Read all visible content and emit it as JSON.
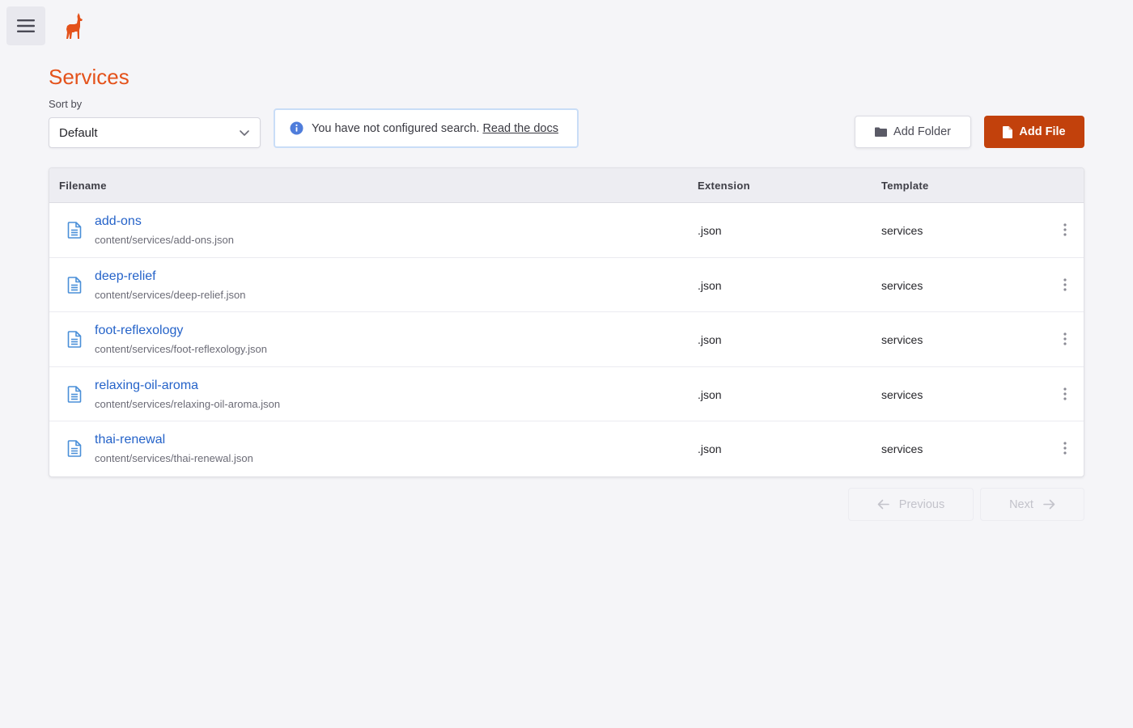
{
  "header": {
    "menu_icon": "hamburger-icon",
    "logo_icon": "llama-logo",
    "brand_color": "#e4521b"
  },
  "page": {
    "title": "Services",
    "sort_label": "Sort by",
    "sort_value": "Default"
  },
  "search_notice": {
    "text": "You have not configured search.",
    "link": "Read the docs"
  },
  "actions": {
    "add_folder": "Add Folder",
    "add_file": "Add File",
    "accent_color": "#c2410c"
  },
  "table": {
    "columns": {
      "filename": "Filename",
      "extension": "Extension",
      "template": "Template"
    },
    "rows": [
      {
        "name": "add-ons",
        "path": "content/services/add-ons.json",
        "extension": ".json",
        "template": "services"
      },
      {
        "name": "deep-relief",
        "path": "content/services/deep-relief.json",
        "extension": ".json",
        "template": "services"
      },
      {
        "name": "foot-reflexology",
        "path": "content/services/foot-reflexology.json",
        "extension": ".json",
        "template": "services"
      },
      {
        "name": "relaxing-oil-aroma",
        "path": "content/services/relaxing-oil-aroma.json",
        "extension": ".json",
        "template": "services"
      },
      {
        "name": "thai-renewal",
        "path": "content/services/thai-renewal.json",
        "extension": ".json",
        "template": "services"
      }
    ]
  },
  "pagination": {
    "previous": "Previous",
    "next": "Next"
  }
}
